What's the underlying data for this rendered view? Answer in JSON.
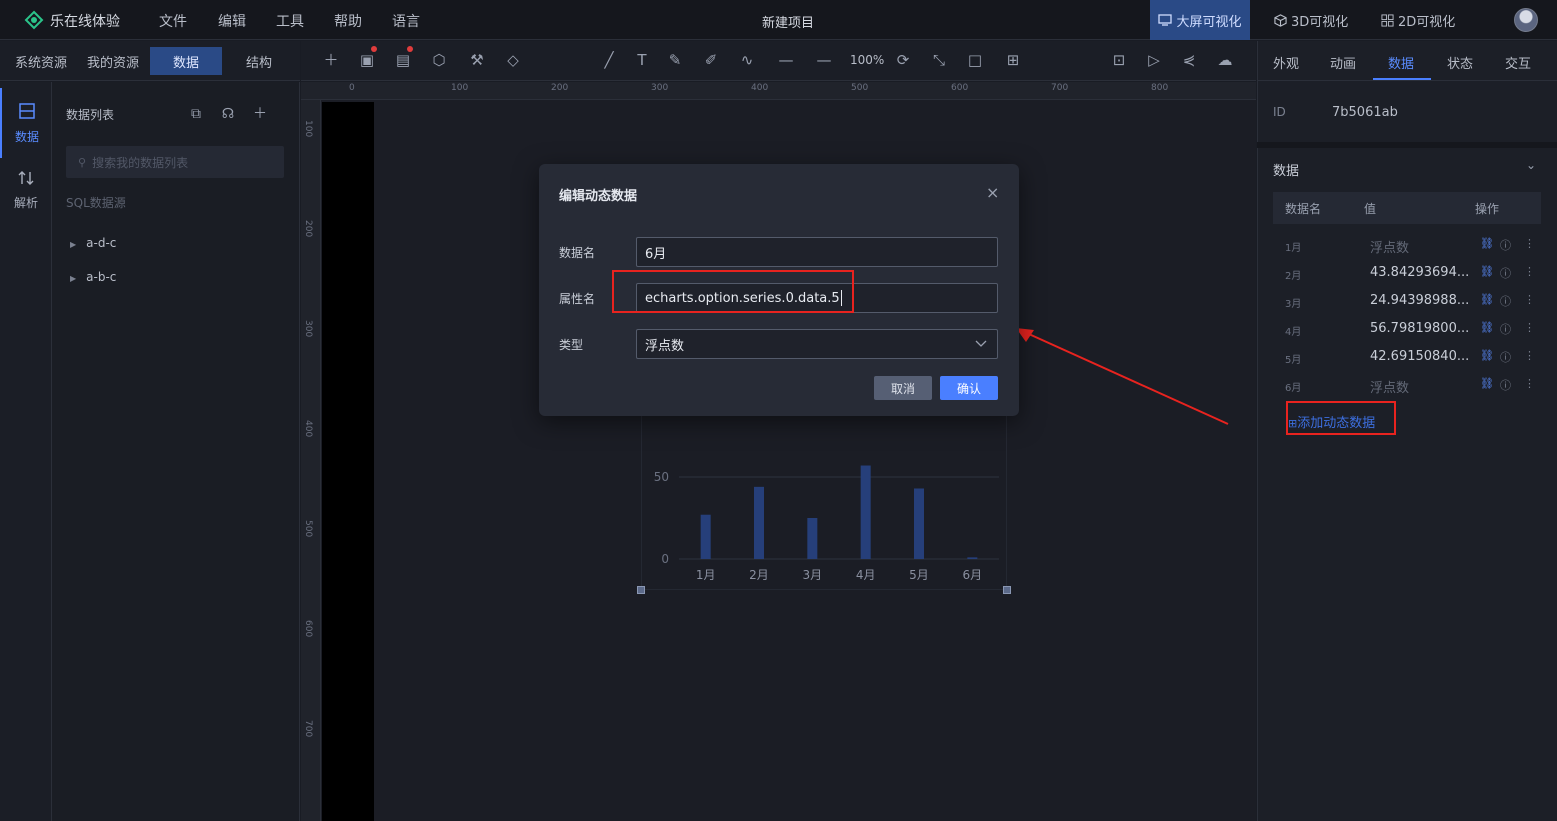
{
  "app": {
    "title": "乐在线体验",
    "project_title": "新建项目"
  },
  "menu": [
    "文件",
    "编辑",
    "工具",
    "帮助",
    "语言"
  ],
  "modes": {
    "large": "大屏可视化",
    "three_d": "3D可视化",
    "two_d": "2D可视化"
  },
  "left_tabs": [
    "系统资源",
    "我的资源",
    "数据",
    "结构"
  ],
  "left_rail": {
    "data": "数据",
    "parse": "解析"
  },
  "data_list": {
    "title": "数据列表",
    "search_placeholder": "搜索我的数据列表",
    "sql_label": "SQL数据源",
    "items": [
      "a-d-c",
      "a-b-c"
    ]
  },
  "toolbar": {
    "zoom": "100%"
  },
  "ruler": {
    "top": [
      "0",
      "100",
      "200",
      "300",
      "400",
      "500",
      "600",
      "700",
      "800"
    ],
    "left": [
      "100",
      "200",
      "300",
      "400",
      "500",
      "600",
      "700"
    ]
  },
  "chart_data": {
    "type": "bar",
    "categories": [
      "1月",
      "2月",
      "3月",
      "4月",
      "5月",
      "6月"
    ],
    "values": [
      27,
      44,
      25,
      57,
      43,
      1
    ],
    "ytick_labels": [
      "0",
      "50"
    ],
    "ylim": [
      0,
      60
    ],
    "grid": true,
    "bar_color": "#263f7a"
  },
  "modal": {
    "title": "编辑动态数据",
    "close": "×",
    "fields": {
      "name_label": "数据名",
      "name_value": "6月",
      "prop_label": "属性名",
      "prop_value": "echarts.option.series.0.data.5",
      "type_label": "类型",
      "type_value": "浮点数"
    },
    "cancel": "取消",
    "confirm": "确认"
  },
  "right_panel": {
    "tabs": [
      "外观",
      "动画",
      "数据",
      "状态",
      "交互"
    ],
    "id_label": "ID",
    "id_value": "7b5061ab",
    "section_title": "数据",
    "table_headers": [
      "数据名",
      "值",
      "操作"
    ],
    "rows": [
      {
        "name": "1月",
        "value": "浮点数"
      },
      {
        "name": "2月",
        "value": "43.84293694..."
      },
      {
        "name": "3月",
        "value": "24.94398988..."
      },
      {
        "name": "4月",
        "value": "56.79819800..."
      },
      {
        "name": "5月",
        "value": "42.69150840..."
      },
      {
        "name": "6月",
        "value": "浮点数"
      }
    ],
    "add_button": "添加动态数据"
  },
  "colors": {
    "accent": "#4a7fff",
    "highlight": "#e8231f",
    "active_tab_bg": "#2a4a86"
  }
}
